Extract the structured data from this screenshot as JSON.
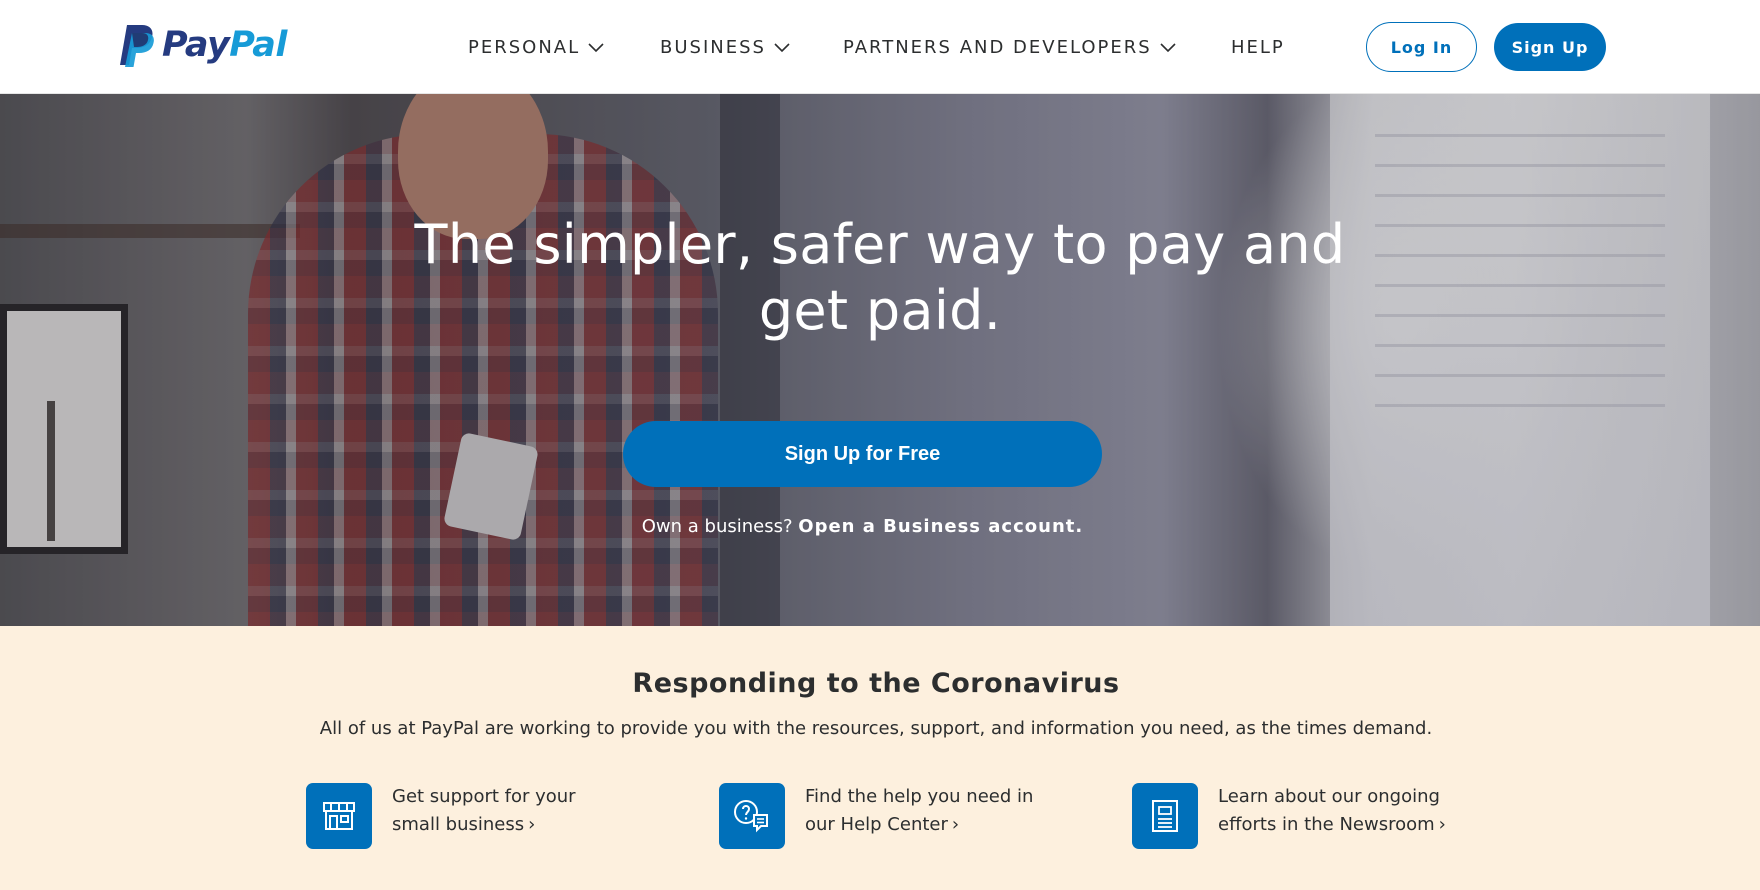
{
  "brand": {
    "logo_icon": "paypal-p-icon",
    "logo_pay": "Pay",
    "logo_pal": "Pal",
    "colors": {
      "primary": "#0070ba",
      "logo_dark": "#253b80",
      "logo_light": "#179bd7",
      "band": "#fdf0de"
    }
  },
  "nav": {
    "items": [
      {
        "label": "PERSONAL",
        "icon": "chevron-down-icon"
      },
      {
        "label": "BUSINESS",
        "icon": "chevron-down-icon"
      },
      {
        "label": "PARTNERS AND DEVELOPERS",
        "icon": "chevron-down-icon"
      },
      {
        "label": "HELP"
      }
    ],
    "login_label": "Log In",
    "signup_label": "Sign Up"
  },
  "hero": {
    "title": "The simpler, safer way to pay and get paid.",
    "cta_label": "Sign Up for Free",
    "sub_prefix": "Own a business? ",
    "sub_link": "Open a Business account."
  },
  "covid": {
    "title": "Responding to the Coronavirus",
    "description": "All of us at PayPal are working to provide you with the resources, support, and information you need, as the times demand.",
    "cards": [
      {
        "icon": "storefront-icon",
        "line1": "Get support for your",
        "line2": "small business",
        "arrow": "›"
      },
      {
        "icon": "help-chat-icon",
        "line1": "Find the help you need in",
        "line2": "our Help Center",
        "arrow": "›"
      },
      {
        "icon": "newsroom-document-icon",
        "line1": "Learn about our ongoing",
        "line2": "efforts in the Newsroom",
        "arrow": "›"
      }
    ]
  }
}
